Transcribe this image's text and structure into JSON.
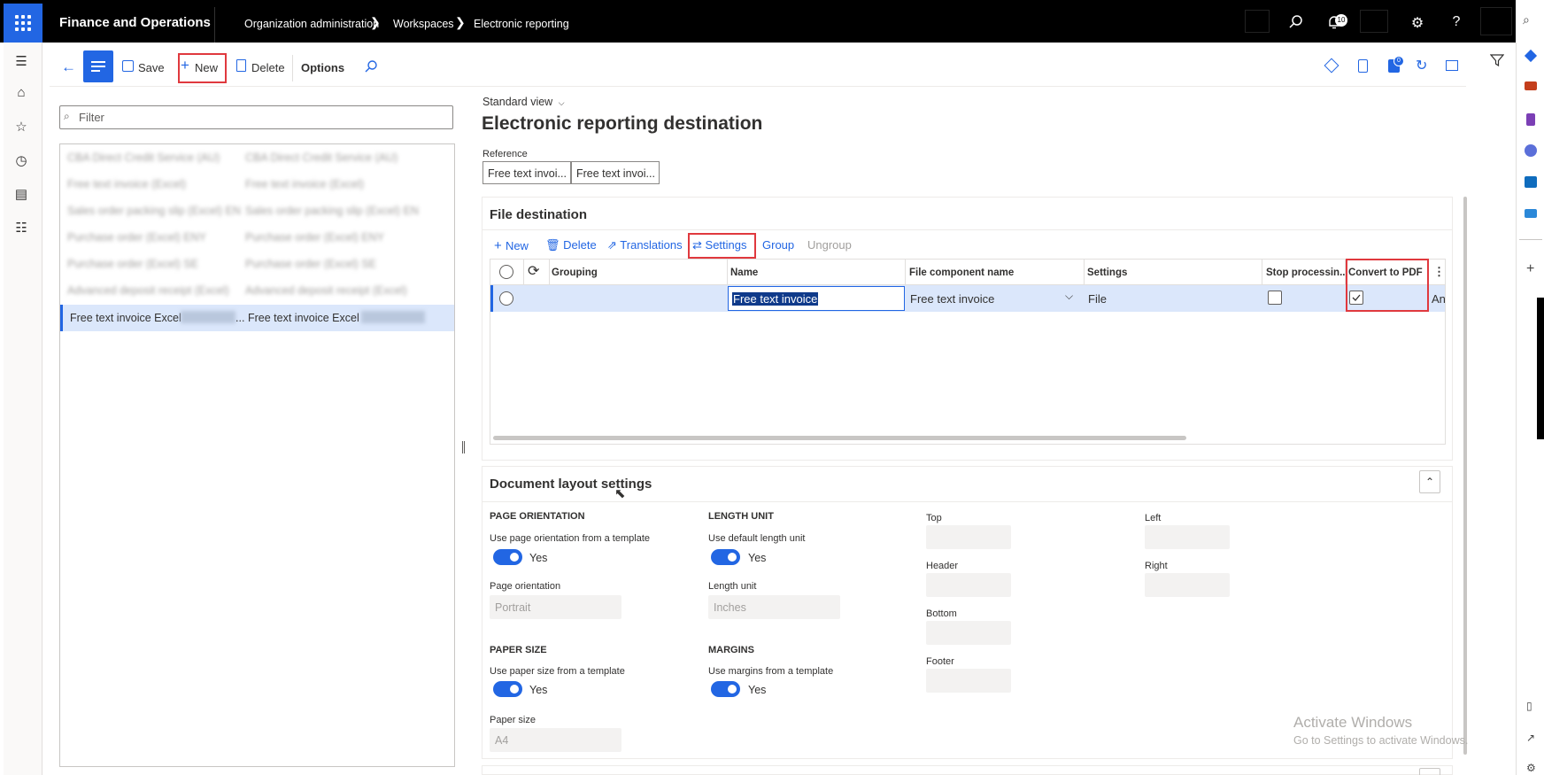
{
  "header": {
    "app_title": "Finance and Operations",
    "breadcrumb": [
      "Organization administration",
      "Workspaces",
      "Electronic reporting"
    ],
    "notification_count": "10"
  },
  "toolbar": {
    "save_label": "Save",
    "new_label": "New",
    "delete_label": "Delete",
    "options_label": "Options",
    "message_count": "0"
  },
  "list": {
    "filter_placeholder": "Filter",
    "rows": [
      {
        "col1": "CBA Direct Credit Service (AU)",
        "col2": "CBA Direct Credit Service (AU)"
      },
      {
        "col1": "Free text invoice (Excel)",
        "col2": "Free text invoice (Excel)"
      },
      {
        "col1": "Sales order packing slip (Excel) EN",
        "col2": "Sales order packing slip (Excel) EN"
      },
      {
        "col1": "Purchase order (Excel) ENY",
        "col2": "Purchase order (Excel) ENY"
      },
      {
        "col1": "Purchase order (Excel) SE",
        "col2": "Purchase order (Excel) SE"
      },
      {
        "col1": "Advanced deposit receipt (Excel)",
        "col2": "Advanced deposit receipt (Excel)"
      }
    ],
    "selected_row": {
      "col1": "Free text invoice Excel",
      "col1_suffix": "...",
      "col2": "Free text invoice Excel"
    }
  },
  "page": {
    "view_name": "Standard view",
    "title": "Electronic reporting destination",
    "reference_label": "Reference",
    "reference_values": [
      "Free text invoi...",
      "Free text invoi..."
    ]
  },
  "file_destination": {
    "title": "File destination",
    "toolbar": {
      "new": "New",
      "delete": "Delete",
      "translations": "Translations",
      "settings": "Settings",
      "group": "Group",
      "ungroup": "Ungroup"
    },
    "columns": {
      "grouping": "Grouping",
      "name": "Name",
      "file_component_name": "File component name",
      "settings": "Settings",
      "stop_processing": "Stop processin...",
      "convert_to_pdf": "Convert to PDF"
    },
    "row": {
      "name": "Free text invoice",
      "file_component_name": "Free text invoice",
      "settings": "File",
      "overflow": "Any",
      "stop_processing": false,
      "convert_to_pdf": true
    }
  },
  "document_layout": {
    "title": "Document layout settings",
    "page_orientation": {
      "heading": "PAGE ORIENTATION",
      "toggle_label": "Use page orientation from a template",
      "toggle_value": "Yes",
      "field_label": "Page orientation",
      "field_value": "Portrait"
    },
    "length_unit": {
      "heading": "LENGTH UNIT",
      "toggle_label": "Use default length unit",
      "toggle_value": "Yes",
      "field_label": "Length unit",
      "field_value": "Inches"
    },
    "paper_size": {
      "heading": "PAPER SIZE",
      "toggle_label": "Use paper size from a template",
      "toggle_value": "Yes",
      "field_label": "Paper size",
      "field_value": "A4"
    },
    "margins": {
      "heading": "MARGINS",
      "toggle_label": "Use margins from a template",
      "toggle_value": "Yes"
    },
    "margin_fields": {
      "top": "Top",
      "header": "Header",
      "bottom": "Bottom",
      "footer": "Footer",
      "left": "Left",
      "right": "Right"
    }
  },
  "watermark": {
    "line1": "Activate Windows",
    "line2": "Go to Settings to activate Windows."
  },
  "colors": {
    "accent": "#2266e3",
    "highlight_box": "#e0393e",
    "topbar": "#000000"
  }
}
